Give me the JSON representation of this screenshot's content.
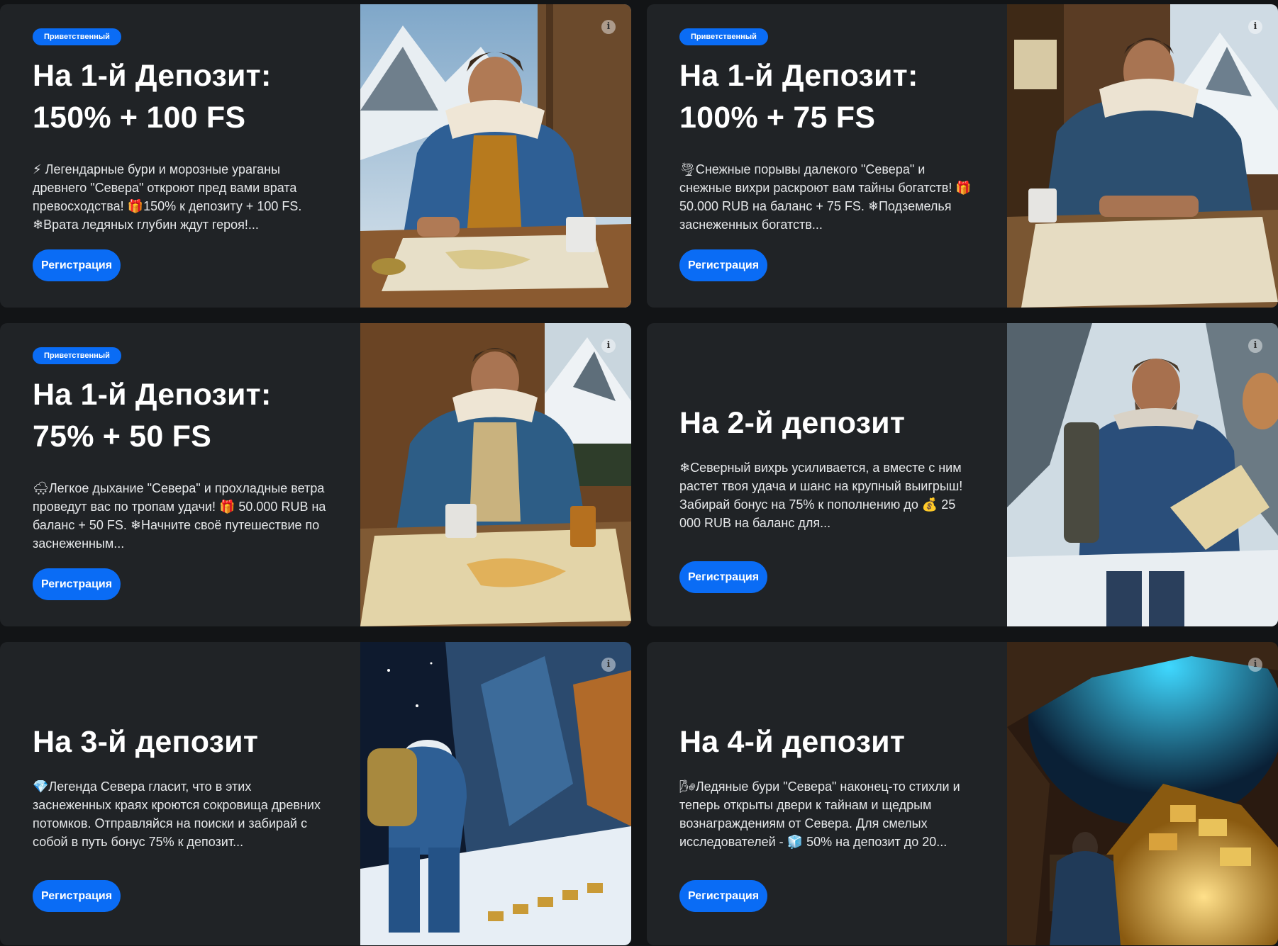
{
  "cards": [
    {
      "badge": "Приветственный",
      "title": "На 1-й Депозит: 150% + 100 FS",
      "description": "⚡ Легендарные бури и морозные ураганы древнего \"Севера\" откроют пред вами врата превосходства! 🎁150% к депозиту + 100 FS. ❄Врата ледяных глубин ждут героя!...",
      "button": "Регистрация"
    },
    {
      "badge": "Приветственный",
      "title": "На 1-й Депозит: 100% + 75 FS",
      "description": "🌪Снежные порывы далекого \"Севера\" и снежные вихри раскроют вам тайны богатств! 🎁50.000 RUB на баланс + 75 FS. ❄Подземелья заснеженных богатств...",
      "button": "Регистрация"
    },
    {
      "badge": "Приветственный",
      "title": "На 1-й Депозит: 75% + 50 FS",
      "description": "🌨Легкое дыхание \"Севера\" и прохладные ветра проведут вас по тропам удачи! 🎁 50.000 RUB на баланс + 50 FS. ❄Начните своё путешествие по заснеженным...",
      "button": "Регистрация"
    },
    {
      "badge": "",
      "title": "На 2-й депозит",
      "description": "❄Северный вихрь усиливается, а вместе с ним растет твоя удача и шанс на крупный выигрыш! Забирай бонус на 75% к пополнению до 💰 25 000 RUB на баланс для...",
      "button": "Регистрация"
    },
    {
      "badge": "",
      "title": "На 3-й депозит",
      "description": "💎Легенда Севера гласит, что в этих заснеженных краях кроются сокровища древних потомков. Отправляйся на поиски и забирай с собой в путь бонус 75% к депозит...",
      "button": "Регистрация"
    },
    {
      "badge": "",
      "title": "На 4-й депозит",
      "description": "🌬Ледяные бури \"Севера\" наконец-то стихли и теперь открыты двери к тайнам и щедрым вознаграждениям от Севера. Для смелых исследователей - 🧊 50% на депозит до 20...",
      "button": "Регистрация"
    }
  ],
  "icons": {
    "info": "info-icon"
  },
  "colors": {
    "accent": "#0a6cf5",
    "card_bg": "#202326",
    "page_bg": "#121416"
  }
}
